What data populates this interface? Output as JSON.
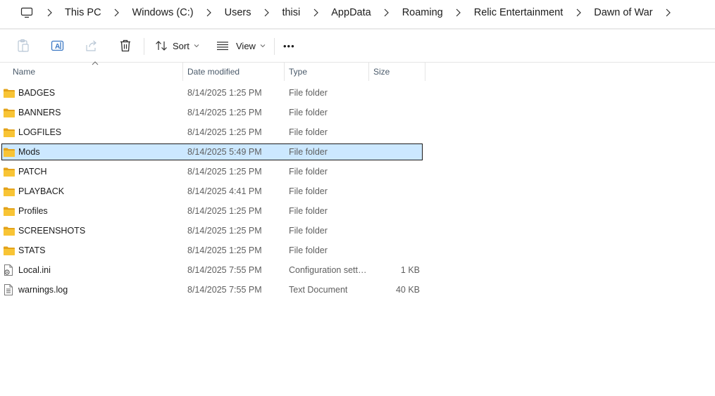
{
  "address": {
    "root_icon": "monitor-icon",
    "crumbs": [
      "This PC",
      "Windows (C:)",
      "Users",
      "thisi",
      "AppData",
      "Roaming",
      "Relic Entertainment",
      "Dawn of War"
    ]
  },
  "toolbar": {
    "sort_label": "Sort",
    "view_label": "View",
    "more_label": "•••"
  },
  "columns": {
    "name": "Name",
    "date": "Date modified",
    "type": "Type",
    "size": "Size",
    "sort": "name-ascending"
  },
  "files": [
    {
      "name": "BADGES",
      "date": "8/14/2025 1:25 PM",
      "type": "File folder",
      "size": "",
      "icon": "folder-icon"
    },
    {
      "name": "BANNERS",
      "date": "8/14/2025 1:25 PM",
      "type": "File folder",
      "size": "",
      "icon": "folder-icon"
    },
    {
      "name": "LOGFILES",
      "date": "8/14/2025 1:25 PM",
      "type": "File folder",
      "size": "",
      "icon": "folder-icon"
    },
    {
      "name": "Mods",
      "date": "8/14/2025 5:49 PM",
      "type": "File folder",
      "size": "",
      "icon": "folder-icon",
      "selected": true
    },
    {
      "name": "PATCH",
      "date": "8/14/2025 1:25 PM",
      "type": "File folder",
      "size": "",
      "icon": "folder-icon"
    },
    {
      "name": "PLAYBACK",
      "date": "8/14/2025 4:41 PM",
      "type": "File folder",
      "size": "",
      "icon": "folder-icon"
    },
    {
      "name": "Profiles",
      "date": "8/14/2025 1:25 PM",
      "type": "File folder",
      "size": "",
      "icon": "folder-icon"
    },
    {
      "name": "SCREENSHOTS",
      "date": "8/14/2025 1:25 PM",
      "type": "File folder",
      "size": "",
      "icon": "folder-icon"
    },
    {
      "name": "STATS",
      "date": "8/14/2025 1:25 PM",
      "type": "File folder",
      "size": "",
      "icon": "folder-icon"
    },
    {
      "name": "Local.ini",
      "date": "8/14/2025 7:55 PM",
      "type": "Configuration sett…",
      "size": "1 KB",
      "icon": "config-file-icon"
    },
    {
      "name": "warnings.log",
      "date": "8/14/2025 7:55 PM",
      "type": "Text Document",
      "size": "40 KB",
      "icon": "text-file-icon"
    }
  ],
  "colors": {
    "selection_bg": "#cce8ff",
    "folder_yellow": "#f8c435",
    "folder_dark": "#e3a21a"
  }
}
